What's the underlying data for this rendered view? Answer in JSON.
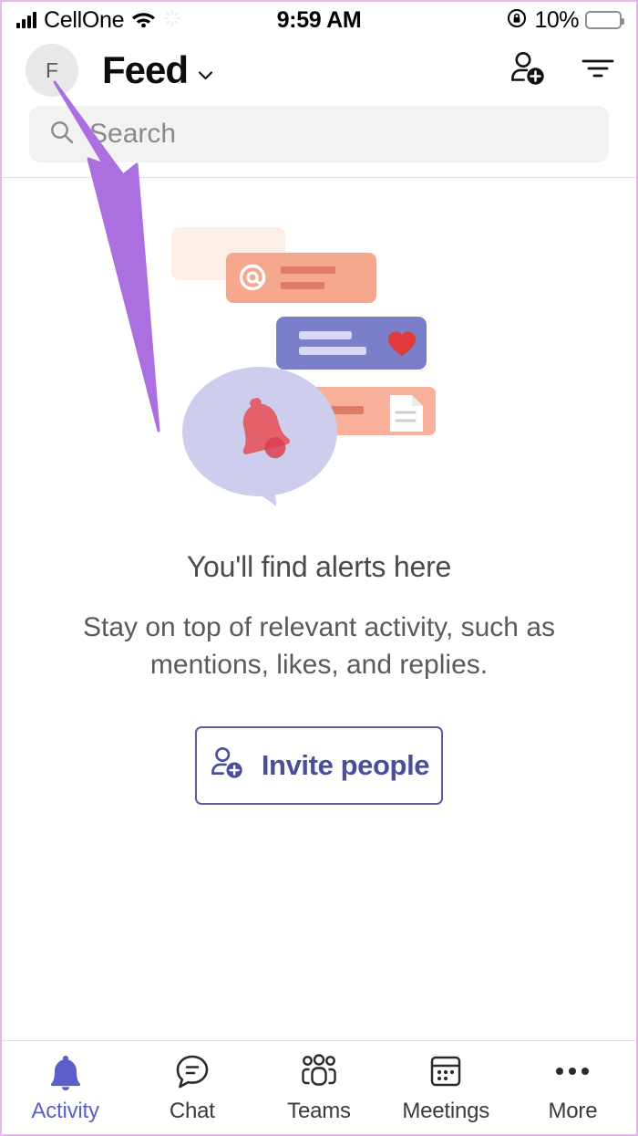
{
  "status_bar": {
    "carrier": "CellOne",
    "signal_icon": "cellular-signal-icon",
    "wifi_icon": "wifi-icon",
    "time": "9:59 AM",
    "orientation_lock_icon": "rotation-lock-icon",
    "battery_percent": "10%",
    "battery_level": 10,
    "battery_color": "#ff3b30",
    "battery_icon": "battery-icon"
  },
  "header": {
    "avatar_initial": "F",
    "avatar_bg": "#e8e8e8",
    "title": "Feed",
    "chevron_icon": "chevron-down-icon",
    "add_person_icon": "add-person-icon",
    "filter_icon": "filter-icon"
  },
  "search": {
    "placeholder": "Search",
    "value": "",
    "icon": "search-icon"
  },
  "empty_state": {
    "title": "You'll find alerts here",
    "subtitle": "Stay on top of relevant activity, such as mentions, likes, and replies.",
    "illustration_name": "activity-alerts-illustration",
    "illustration_parts": [
      {
        "name": "faded-card",
        "color": "#fdeee6"
      },
      {
        "name": "mention-card",
        "color": "#f6a88f",
        "icon": "at-mention-icon"
      },
      {
        "name": "like-card",
        "color": "#7b7fca",
        "icon": "heart-icon"
      },
      {
        "name": "file-card",
        "color": "#f8b09a",
        "icon": "document-icon"
      },
      {
        "name": "speech-bubble",
        "color": "#cfcdee",
        "icon": "bell-icon"
      }
    ],
    "invite_button": {
      "label": "Invite people",
      "icon": "add-person-icon",
      "border_color": "#5b5d9e",
      "text_color": "#4a4e9b"
    }
  },
  "bottom_nav": {
    "active_color": "#5b5fc7",
    "items": [
      {
        "label": "Activity",
        "icon": "bell-icon",
        "active": true
      },
      {
        "label": "Chat",
        "icon": "chat-bubble-icon",
        "active": false
      },
      {
        "label": "Teams",
        "icon": "teams-people-icon",
        "active": false
      },
      {
        "label": "Meetings",
        "icon": "calendar-icon",
        "active": false
      },
      {
        "label": "More",
        "icon": "ellipsis-icon",
        "active": false
      }
    ]
  },
  "annotation": {
    "arrow_name": "annotation-arrow",
    "arrow_color": "#ab6fe0",
    "points_to": "avatar"
  }
}
